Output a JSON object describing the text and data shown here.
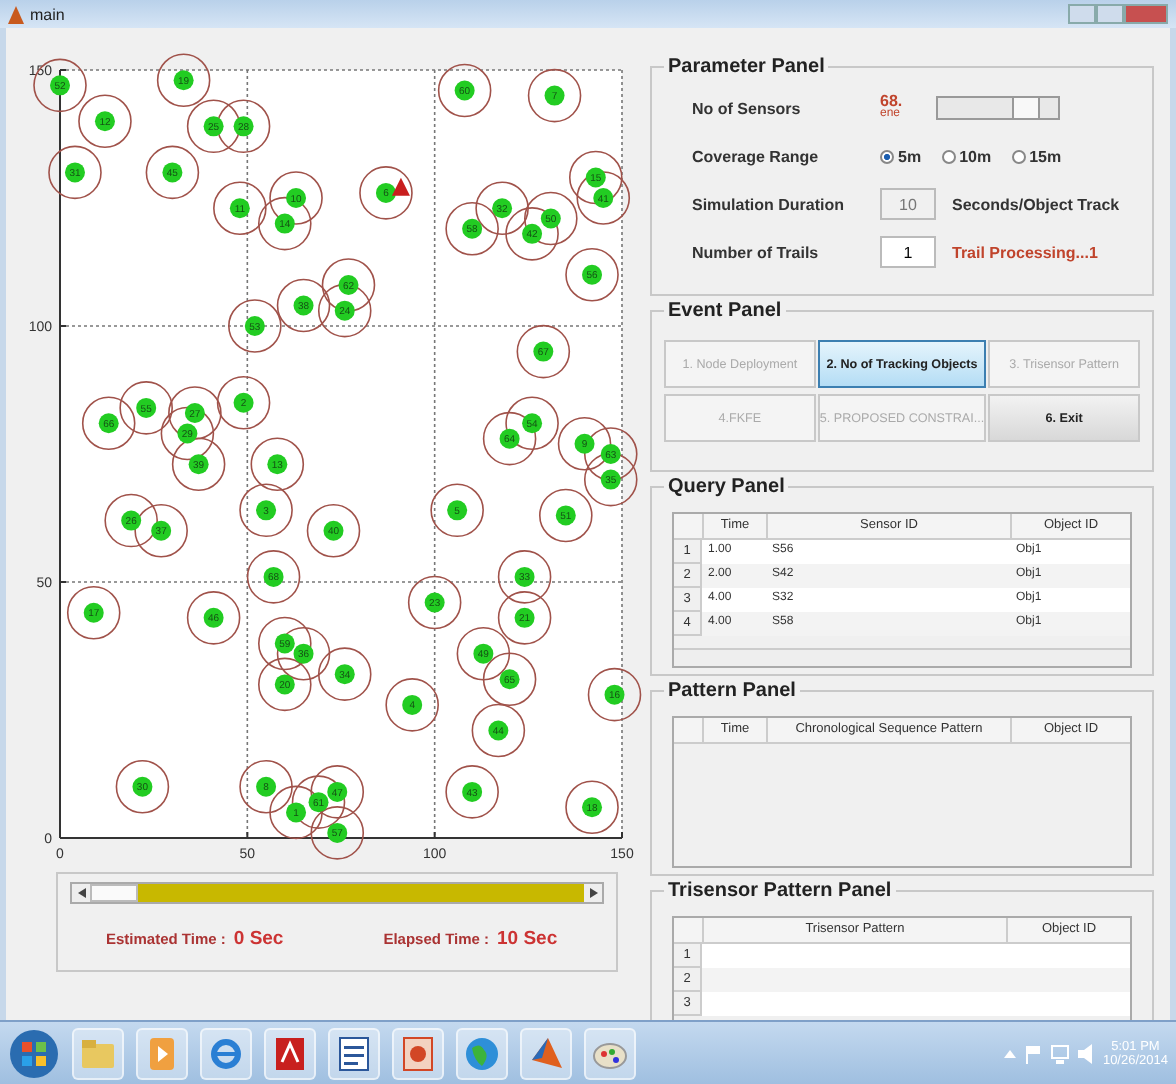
{
  "window": {
    "title": "main"
  },
  "plot": {
    "chart_data": {
      "type": "scatter",
      "xlim": [
        0,
        150
      ],
      "ylim": [
        0,
        150
      ],
      "xticks": [
        0,
        50,
        100,
        150
      ],
      "yticks": [
        0,
        50,
        100,
        150
      ],
      "x": [
        0,
        33,
        12,
        41,
        49,
        4,
        30,
        48,
        63,
        60,
        87,
        108,
        132,
        110,
        118,
        126,
        131,
        143,
        145,
        142,
        52,
        65,
        77,
        76,
        129,
        13,
        23,
        36,
        34,
        49,
        37,
        58,
        120,
        126,
        140,
        147,
        147,
        19,
        27,
        55,
        73,
        106,
        135,
        57,
        9,
        41,
        100,
        124,
        124,
        60,
        65,
        60,
        76,
        94,
        113,
        120,
        117,
        148,
        22,
        55,
        63,
        69,
        74,
        74,
        110,
        142,
        91
      ],
      "grid": true,
      "series": [
        {
          "color": "#22cc22",
          "values": [
            147,
            148,
            140,
            139,
            139,
            130,
            130,
            123,
            125,
            120,
            126,
            146,
            145,
            119,
            123,
            118,
            121,
            129,
            125,
            110,
            100,
            104,
            108,
            103,
            95,
            81,
            84,
            83,
            79,
            85,
            73,
            73,
            78,
            81,
            77,
            75,
            70,
            62,
            60,
            64,
            60,
            64,
            63,
            51,
            44,
            43,
            46,
            51,
            43,
            38,
            36,
            30,
            32,
            26,
            36,
            31,
            21,
            28,
            10,
            10,
            5,
            7,
            9,
            1,
            9,
            6,
            null
          ]
        },
        {
          "color": "#c81e1e",
          "values": [
            null,
            null,
            null,
            null,
            null,
            null,
            null,
            null,
            null,
            null,
            null,
            null,
            null,
            null,
            null,
            null,
            null,
            null,
            null,
            null,
            null,
            null,
            null,
            null,
            null,
            null,
            null,
            null,
            null,
            null,
            null,
            null,
            null,
            null,
            null,
            null,
            null,
            null,
            null,
            null,
            null,
            null,
            null,
            null,
            null,
            null,
            null,
            null,
            null,
            null,
            null,
            null,
            null,
            null,
            null,
            null,
            null,
            null,
            null,
            null,
            null,
            null,
            null,
            null,
            null,
            null,
            127
          ]
        }
      ],
      "annotations": [
        "52",
        "19",
        "12",
        "25",
        "28",
        "31",
        "45",
        "11",
        "10",
        "14",
        "6",
        "60",
        "7",
        "58",
        "32",
        "42",
        "50",
        "15",
        "41",
        "56",
        "53",
        "38",
        "62",
        "24",
        "67",
        "66",
        "55",
        "27",
        "29",
        "2",
        "39",
        "13",
        "64",
        "54",
        "9",
        "63",
        "35",
        "26",
        "37",
        "3",
        "40",
        "5",
        "51",
        "68",
        "17",
        "46",
        "23",
        "33",
        "21",
        "59",
        "36",
        "20",
        "34",
        "4",
        "49",
        "65",
        "44",
        "16",
        "30",
        "8",
        "1",
        "61",
        "47",
        "57",
        "43",
        "18"
      ]
    },
    "time_slider": {
      "level": 0
    },
    "estimated_label": "Estimated Time :",
    "estimated_value": "0 Sec",
    "elapsed_label": "Elapsed Time :",
    "elapsed_value": "10 Sec"
  },
  "parameter_panel": {
    "title": "Parameter Panel",
    "sensors": {
      "label": "No of Sensors",
      "value": "68.",
      "value_2": "ene",
      "level": 0.8
    },
    "coverage": {
      "label": "Coverage Range",
      "options": [
        {
          "label": "5m",
          "selected": true
        },
        {
          "label": "10m",
          "selected": false
        },
        {
          "label": "15m",
          "selected": false
        }
      ]
    },
    "duration": {
      "label": "Simulation Duration",
      "value": "10",
      "disabled": true,
      "unit": "Seconds/Object Track"
    },
    "trails": {
      "label": "Number of Trails",
      "value": "1",
      "status": "Trail Processing...1"
    }
  },
  "event_panel": {
    "title": "Event Panel",
    "buttons": [
      {
        "label": "1. Node Deployment",
        "disabled": true,
        "selected": false
      },
      {
        "label": "2. No of Tracking Objects",
        "disabled": false,
        "selected": true
      },
      {
        "label": "3. Trisensor Pattern",
        "disabled": true,
        "selected": false
      },
      {
        "label": "4.FKFE",
        "disabled": true,
        "selected": false
      },
      {
        "label": "5. PROPOSED CONSTRAI...",
        "disabled": true,
        "selected": false
      },
      {
        "label": "6. Exit",
        "disabled": false,
        "selected": false
      }
    ]
  },
  "query_panel": {
    "title": "Query Panel",
    "columns": [
      "Time",
      "Sensor ID",
      "Object ID"
    ],
    "rows": [
      {
        "number": "1",
        "cells": [
          "1.00",
          "S56",
          "Obj1"
        ]
      },
      {
        "number": "2",
        "cells": [
          "2.00",
          "S42",
          "Obj1"
        ]
      },
      {
        "number": "3",
        "cells": [
          "4.00",
          "S32",
          "Obj1"
        ]
      },
      {
        "number": "4",
        "cells": [
          "4.00",
          "S58",
          "Obj1"
        ]
      }
    ]
  },
  "pattern_panel": {
    "title": "Pattern Panel",
    "columns": [
      "Time",
      "Chronological Sequence Pattern",
      "Object ID"
    ]
  },
  "trisensor_panel": {
    "title": "Trisensor Pattern Panel",
    "columns": [
      "Trisensor Pattern",
      "Object ID"
    ],
    "rows": [
      {
        "number": "1"
      },
      {
        "number": "2"
      },
      {
        "number": "3"
      }
    ]
  },
  "taskbar": {
    "apps": [
      {
        "kind": "folder"
      },
      {
        "kind": "media"
      },
      {
        "kind": "browser"
      },
      {
        "kind": "pdf"
      },
      {
        "kind": "document"
      },
      {
        "kind": "slides"
      },
      {
        "kind": "globe"
      },
      {
        "kind": "cone"
      },
      {
        "kind": "paint"
      }
    ],
    "time": "5:01 PM",
    "date": "10/26/2014"
  }
}
